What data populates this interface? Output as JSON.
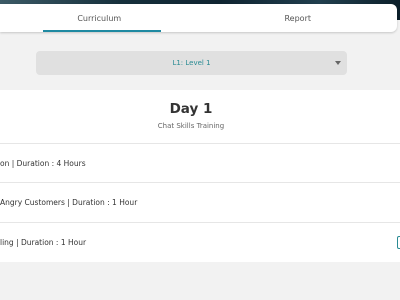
{
  "tabs": [
    {
      "label": "Curriculum",
      "active": true
    },
    {
      "label": "Report",
      "active": false
    }
  ],
  "level_select": {
    "selected": "L1: Level 1"
  },
  "day": {
    "title": "Day 1",
    "subtitle": "Chat Skills Training"
  },
  "sessions": [
    {
      "text": "on | Duration : 4 Hours"
    },
    {
      "text": "Angry Customers | Duration : 1 Hour"
    },
    {
      "text": "ling | Duration : 1 Hour"
    }
  ],
  "colors": {
    "accent": "#2a8b93",
    "tab_underline": "#1f8aa2",
    "background": "#f2f2f2",
    "select_bg": "#e0e0e0"
  }
}
